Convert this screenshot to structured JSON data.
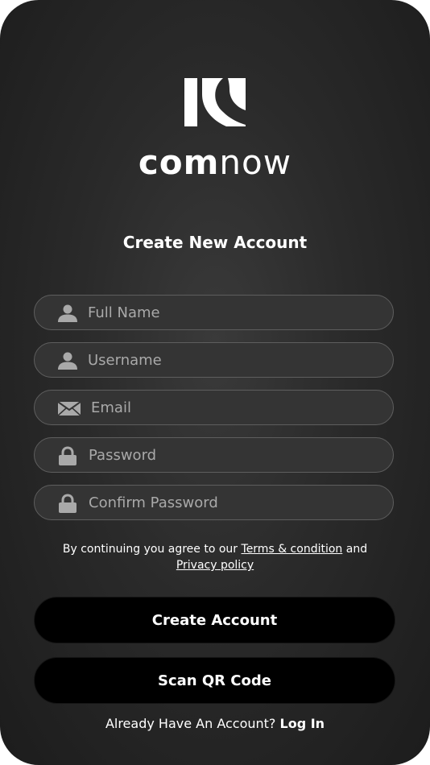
{
  "brand": {
    "name_bold": "com",
    "name_light": "now"
  },
  "screen_title": "Create New Account",
  "fields": [
    {
      "placeholder": "Full Name",
      "icon": "person-icon"
    },
    {
      "placeholder": "Username",
      "icon": "person-icon"
    },
    {
      "placeholder": "Email",
      "icon": "envelope-icon"
    },
    {
      "placeholder": "Password",
      "icon": "lock-icon"
    },
    {
      "placeholder": "Confirm Password",
      "icon": "lock-icon"
    }
  ],
  "terms": {
    "prefix": "By continuing you agree to our ",
    "terms_link": "Terms & condition",
    "middle": " and",
    "privacy_link": "Privacy policy"
  },
  "buttons": {
    "create_account": "Create Account",
    "scan_qr": "Scan QR Code"
  },
  "footer": {
    "prompt": "Already Have An Account? ",
    "login_link": "Log In"
  },
  "colors": {
    "background": "#2a2a2a",
    "field_border": "#5e5e5e",
    "placeholder": "#a9a9a9",
    "button": "#000000",
    "text": "#ffffff"
  }
}
